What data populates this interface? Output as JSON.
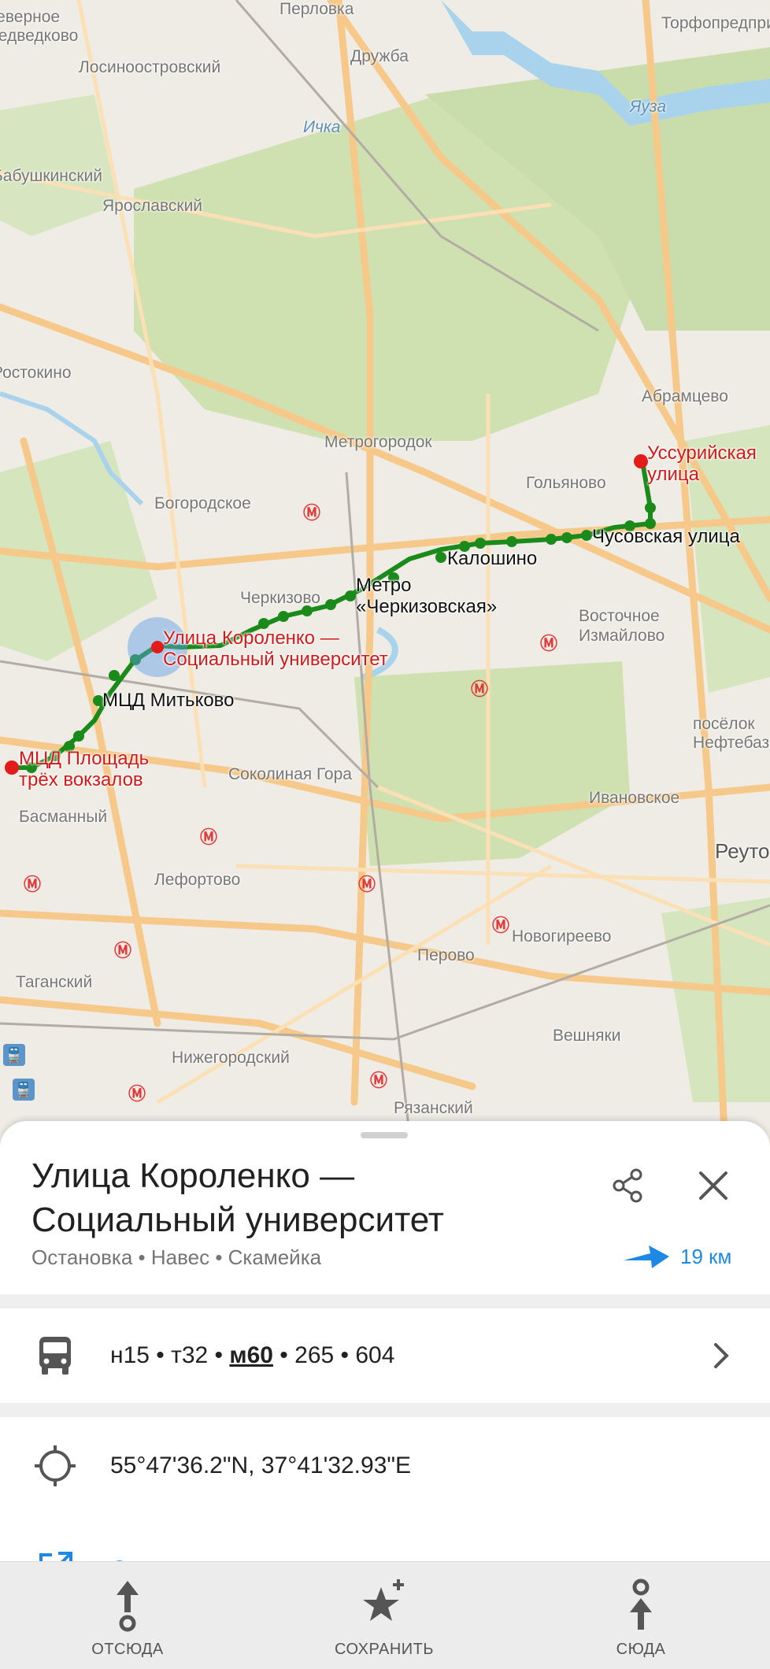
{
  "map": {
    "place_labels": [
      "Перловка",
      "Дружба",
      "Лосиноостровский",
      "Торфопредприятие",
      "Бабушкинский",
      "Ярославский",
      "Ростокино",
      "Абрамцево",
      "Метрогородок",
      "Гольяново",
      "Богородское",
      "Черкизово",
      "Восточное Измайлово",
      "Соколиная Гора",
      "Ивановское",
      "Басманный",
      "Лефортово",
      "Новогиреево",
      "Перово",
      "Таганский",
      "Вешняки",
      "Нижегородский",
      "Рязанский",
      "посёлок Нефтебазы",
      "Реутов",
      "Яуза",
      "Ичка",
      "Северное Медведково"
    ],
    "stops": {
      "start": "Уссурийская улица",
      "s1": "Чусовская улица",
      "s2": "Калошино",
      "s3": "Метро «Черкизовская»",
      "current": "Улица Короленко — Социальный университет",
      "s4": "МЦД Митьково",
      "end": "МЦД Площадь трёх вокзалов"
    },
    "route_color": "#1a8a1a",
    "endpoint_color": "#e31b1b"
  },
  "sheet": {
    "title": "Улица Короленко — Социальный университет",
    "subtitle": "Остановка • Навес • Скамейка",
    "distance": "19 км",
    "routes_prefix": "н15 • т32 • ",
    "routes_highlight": "м60",
    "routes_suffix": " • 265 • 604",
    "coordinates": "55°47'36.2\"N, 37°41'32.93\"E",
    "open_in_app": "Открыть в другом приложении",
    "accent_color": "#1e88e5"
  },
  "nav": {
    "from_label": "ОТСЮДА",
    "save_label": "СОХРАНИТЬ",
    "to_label": "СЮДА"
  }
}
